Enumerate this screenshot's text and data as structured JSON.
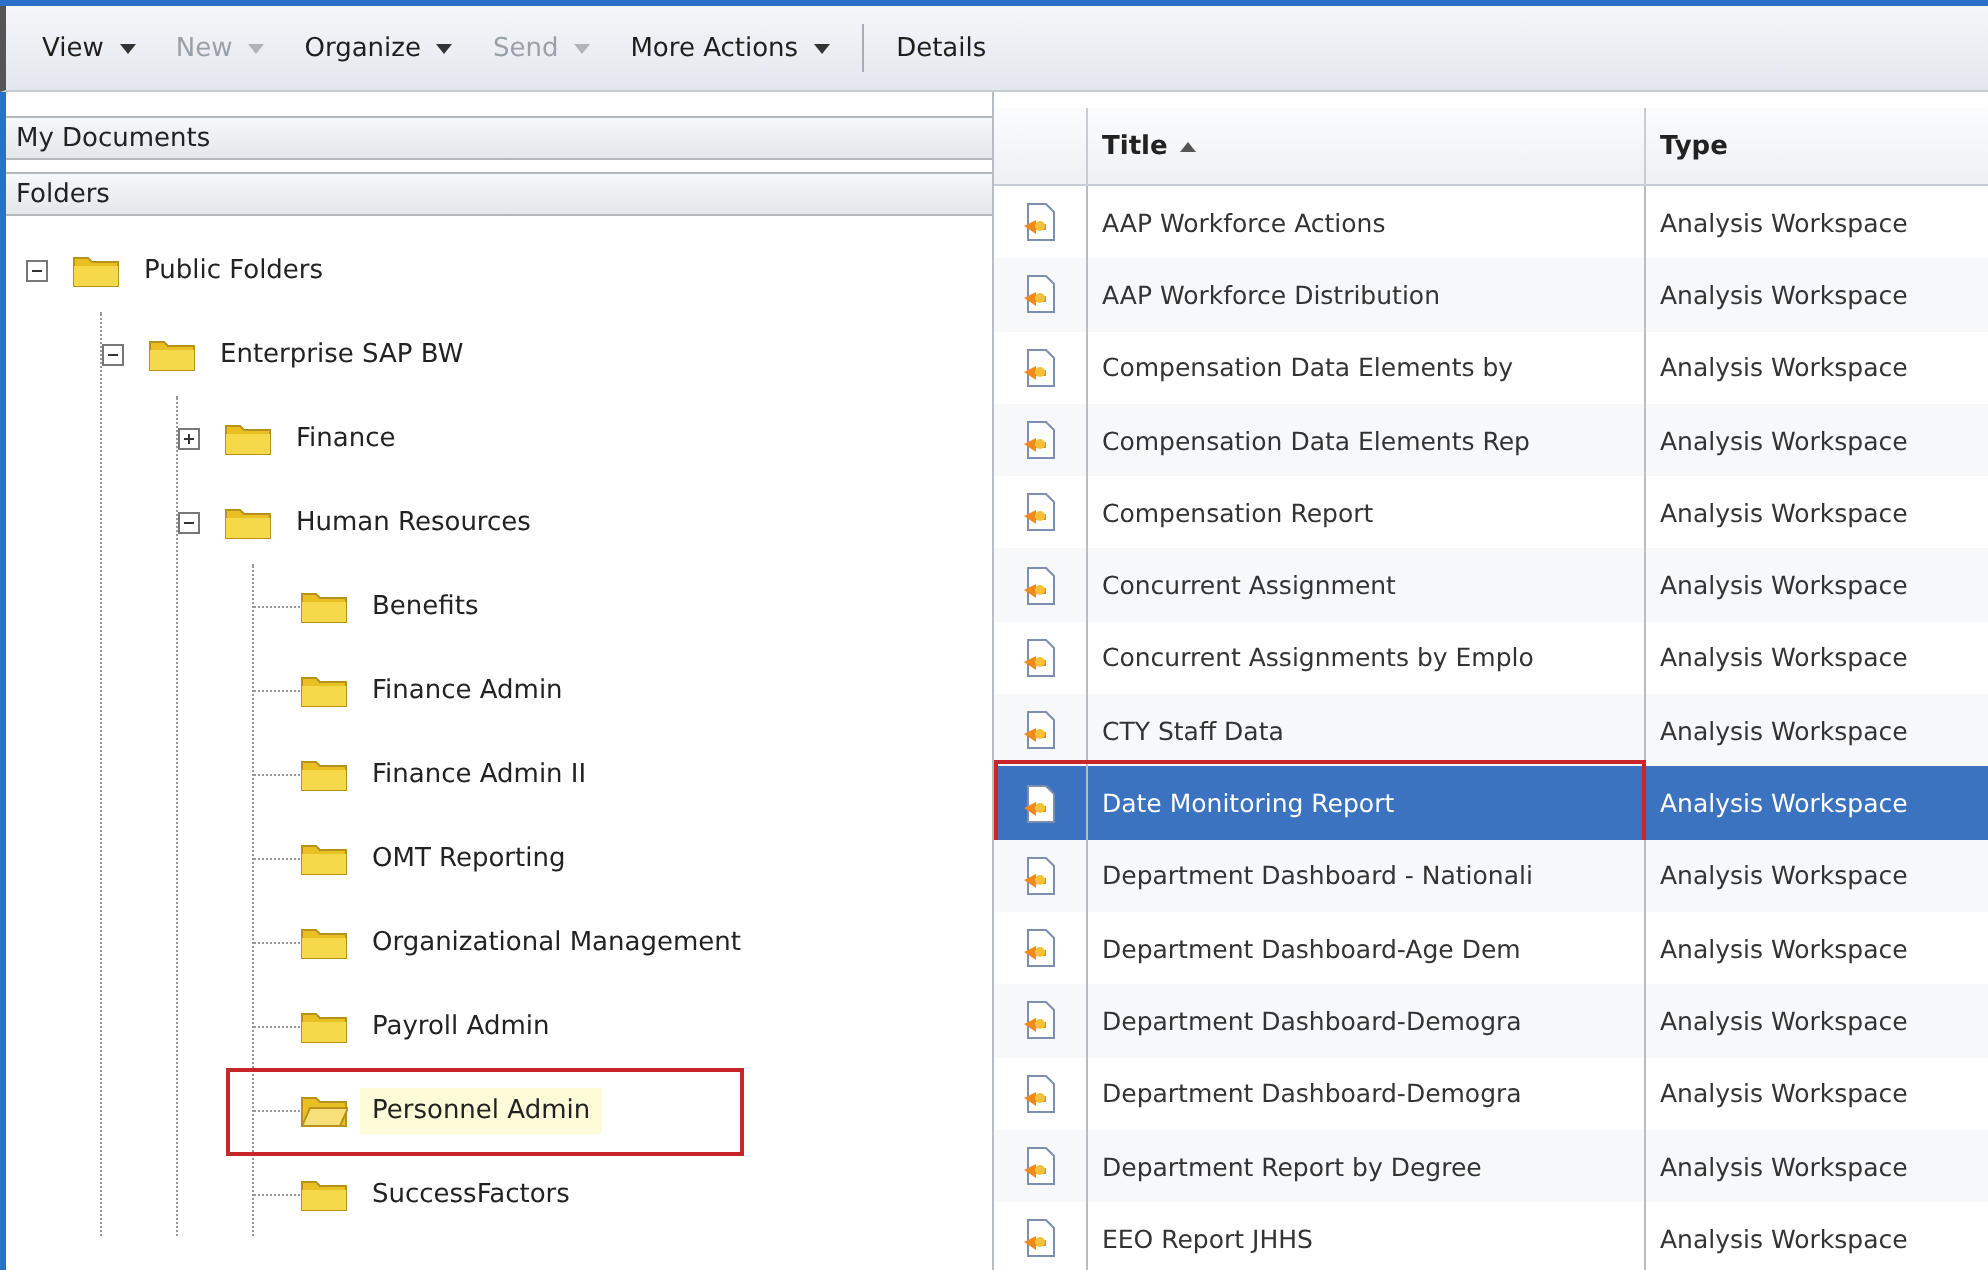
{
  "toolbar": [
    {
      "label": "View",
      "disabled": false,
      "menu": true
    },
    {
      "label": "New",
      "disabled": true,
      "menu": true
    },
    {
      "label": "Organize",
      "disabled": false,
      "menu": true
    },
    {
      "label": "Send",
      "disabled": true,
      "menu": true
    },
    {
      "label": "More Actions",
      "disabled": false,
      "menu": true
    },
    {
      "label": "Details",
      "disabled": false,
      "menu": false
    }
  ],
  "sidebar": {
    "sections": [
      "My Documents",
      "Folders"
    ],
    "tree": [
      {
        "label": "Public Folders",
        "expanded": true,
        "selected": false,
        "children": [
          {
            "label": "Enterprise SAP BW",
            "expanded": true,
            "selected": false,
            "children": [
              {
                "label": "Finance",
                "expanded": false,
                "selected": false
              },
              {
                "label": "Human Resources",
                "expanded": true,
                "selected": false,
                "children": [
                  {
                    "label": "Benefits",
                    "selected": false
                  },
                  {
                    "label": "Finance Admin",
                    "selected": false
                  },
                  {
                    "label": "Finance Admin II",
                    "selected": false
                  },
                  {
                    "label": "OMT Reporting",
                    "selected": false
                  },
                  {
                    "label": "Organizational Management",
                    "selected": false
                  },
                  {
                    "label": "Payroll Admin",
                    "selected": false
                  },
                  {
                    "label": "Personnel Admin",
                    "selected": true,
                    "annotated": true
                  },
                  {
                    "label": "SuccessFactors",
                    "selected": false
                  }
                ]
              }
            ]
          }
        ]
      }
    ]
  },
  "table": {
    "columns": [
      {
        "label": "Title",
        "sorted": true
      },
      {
        "label": "Type",
        "sorted": false
      }
    ],
    "rows": [
      {
        "title": "AAP Workforce Actions",
        "type": "Analysis Workspace",
        "selected": false
      },
      {
        "title": "AAP Workforce Distribution",
        "type": "Analysis Workspace",
        "selected": false
      },
      {
        "title": "Compensation Data Elements by",
        "type": "Analysis Workspace",
        "selected": false
      },
      {
        "title": "Compensation Data Elements Rep",
        "type": "Analysis Workspace",
        "selected": false
      },
      {
        "title": "Compensation Report",
        "type": "Analysis Workspace",
        "selected": false
      },
      {
        "title": "Concurrent Assignment",
        "type": "Analysis Workspace",
        "selected": false
      },
      {
        "title": "Concurrent Assignments by Emplo",
        "type": "Analysis Workspace",
        "selected": false
      },
      {
        "title": "CTY Staff Data",
        "type": "Analysis Workspace",
        "selected": false
      },
      {
        "title": "Date Monitoring Report",
        "type": "Analysis Workspace",
        "selected": true,
        "annotated": true
      },
      {
        "title": "Department Dashboard - Nationali",
        "type": "Analysis Workspace",
        "selected": false
      },
      {
        "title": "Department Dashboard-Age Dem",
        "type": "Analysis Workspace",
        "selected": false
      },
      {
        "title": "Department Dashboard-Demogra",
        "type": "Analysis Workspace",
        "selected": false
      },
      {
        "title": "Department Dashboard-Demogra",
        "type": "Analysis Workspace",
        "selected": false
      },
      {
        "title": "Department Report by Degree",
        "type": "Analysis Workspace",
        "selected": false
      },
      {
        "title": "EEO Report JHHS",
        "type": "Analysis Workspace",
        "selected": false
      }
    ]
  }
}
